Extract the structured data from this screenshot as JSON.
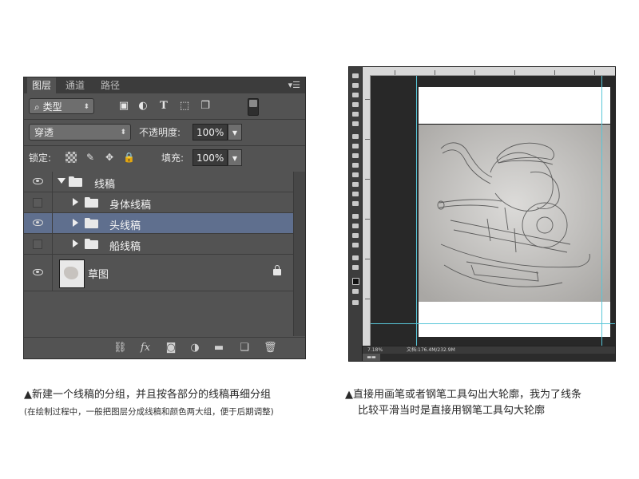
{
  "layers_panel": {
    "tabs": [
      "图层",
      "通道",
      "路径"
    ],
    "menu_icon": "panel-menu-icon",
    "filter": {
      "kind_label": "类型",
      "kind_icon": "search-icon"
    },
    "blend_mode": "穿透",
    "opacity_label": "不透明度:",
    "opacity_value": "100%",
    "lock_label": "锁定:",
    "fill_label": "填充:",
    "fill_value": "100%",
    "layers": [
      {
        "name": "线稿",
        "type": "group",
        "expanded": true,
        "visible": true,
        "indent": 0,
        "selected": false
      },
      {
        "name": "身体线稿",
        "type": "group",
        "expanded": false,
        "visible": false,
        "indent": 1,
        "selected": false
      },
      {
        "name": "头线稿",
        "type": "group",
        "expanded": false,
        "visible": true,
        "indent": 1,
        "selected": true
      },
      {
        "name": "船线稿",
        "type": "group",
        "expanded": false,
        "visible": false,
        "indent": 1,
        "selected": false
      },
      {
        "name": "草图",
        "type": "layer",
        "visible": true,
        "locked": true,
        "indent": 0,
        "selected": false
      }
    ],
    "footer_icons": [
      "link-icon",
      "fx-icon",
      "mask-icon",
      "adjustment-icon",
      "new-group-icon",
      "new-layer-icon",
      "trash-icon"
    ],
    "fx_label": "fx"
  },
  "canvas_window": {
    "zoom": "7.18%",
    "doc_info": "文档:176.4M/232.9M"
  },
  "captions": {
    "left_main": "▲新建一个线稿的分组，并且按各部分的线稿再细分组",
    "left_sub": "(在绘制过程中，一般把图层分成线稿和颜色两大组，便于后期调整)",
    "right_line1": "▲直接用画笔或者钢笔工具勾出大轮廓，我为了线条",
    "right_line2": "比较平滑当时是直接用钢笔工具勾大轮廓"
  }
}
